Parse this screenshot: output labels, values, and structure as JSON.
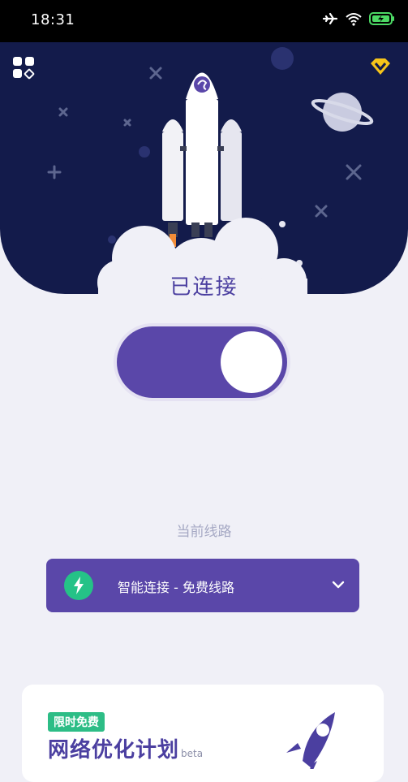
{
  "status_bar": {
    "time": "18:31"
  },
  "main": {
    "connection_status": "已连接",
    "route_label": "当前线路",
    "route": {
      "value": "智能连接 - 免费线路"
    }
  },
  "promo": {
    "badge": "限时免费",
    "title": "网络优化计划",
    "beta_label": "beta"
  },
  "colors": {
    "hero_bg": "#131b4b",
    "accent": "#5a47a9",
    "route_icon": "#25c287",
    "page_bg": "#f0f0f7"
  }
}
